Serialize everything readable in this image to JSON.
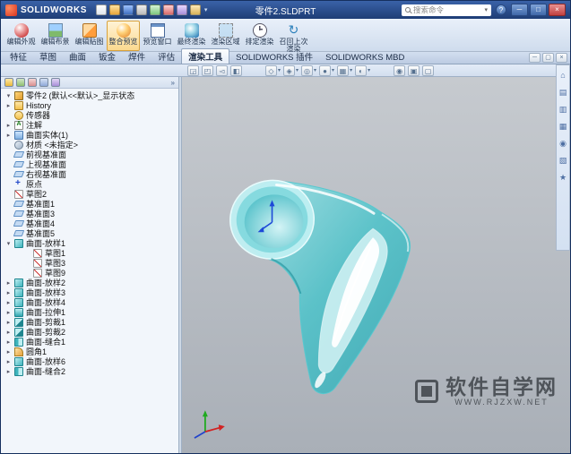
{
  "window": {
    "brand": "SOLIDWORKS",
    "title": "零件2.SLDPRT",
    "search_placeholder": "搜索命令",
    "menu_icons": [
      {
        "name": "new-file-icon",
        "icon": "new-file"
      },
      {
        "name": "open-file-icon",
        "icon": "open-file"
      },
      {
        "name": "save-icon",
        "icon": "save"
      },
      {
        "name": "print-icon",
        "icon": "print"
      },
      {
        "name": "undo-icon",
        "icon": "undo"
      },
      {
        "name": "rebuild-icon",
        "icon": "rebuild"
      },
      {
        "name": "file-properties-icon",
        "icon": "file-properties"
      },
      {
        "name": "options-icon",
        "icon": "options"
      }
    ],
    "controls": [
      {
        "name": "minimize-button",
        "glyph": "─"
      },
      {
        "name": "maximize-button",
        "glyph": "□"
      },
      {
        "name": "close-button",
        "glyph": "×"
      }
    ]
  },
  "ribbon": {
    "buttons": [
      {
        "label": "编辑外观",
        "icon": "edit-appearance"
      },
      {
        "label": "编辑布景",
        "icon": "edit-scene"
      },
      {
        "label": "编辑贴图",
        "icon": "edit-decal"
      },
      {
        "label": "整合预览",
        "icon": "integrated-preview",
        "active": "true"
      },
      {
        "label": "预览窗口",
        "icon": "preview-window"
      },
      {
        "label": "最终渲染",
        "icon": "final-render"
      },
      {
        "label": "渲染区域",
        "icon": "render-region"
      },
      {
        "label": "排定渲染",
        "icon": "schedule-render"
      },
      {
        "label": "召回上次渲染",
        "icon": "recall-last-render"
      }
    ]
  },
  "tabs": {
    "items": [
      {
        "label": "特征"
      },
      {
        "label": "草图"
      },
      {
        "label": "曲面"
      },
      {
        "label": "钣金"
      },
      {
        "label": "焊件"
      },
      {
        "label": "评估"
      },
      {
        "label": "渲染工具",
        "active": "true"
      },
      {
        "label": "SOLIDWORKS 插件"
      },
      {
        "label": "SOLIDWORKS MBD"
      }
    ],
    "right_icons": [
      {
        "name": "doc-minimize-icon",
        "glyph": "─"
      },
      {
        "name": "doc-restore-icon",
        "glyph": "▢"
      },
      {
        "name": "doc-close-icon",
        "glyph": "×"
      }
    ]
  },
  "viewbar": {
    "left_icons": [
      {
        "name": "zoom-fit-icon",
        "glyph": "◲"
      },
      {
        "name": "zoom-area-icon",
        "glyph": "◰"
      },
      {
        "name": "previous-view-icon",
        "glyph": "◅"
      },
      {
        "name": "section-view-icon",
        "glyph": "◧"
      }
    ],
    "center_icons": [
      {
        "name": "view-orientation-icon",
        "glyph": "◇"
      },
      {
        "name": "display-style-icon",
        "glyph": "◈"
      },
      {
        "name": "hide-show-items-icon",
        "glyph": "◎"
      },
      {
        "name": "edit-appearance-icon",
        "glyph": "●"
      },
      {
        "name": "apply-scene-icon",
        "glyph": "▦"
      },
      {
        "name": "view-settings-icon",
        "glyph": "◐"
      }
    ],
    "right_icons": [
      {
        "name": "camera-icon",
        "glyph": "◉"
      },
      {
        "name": "photoview-options-icon",
        "glyph": "▣"
      },
      {
        "name": "full-screen-icon",
        "glyph": "▢"
      }
    ]
  },
  "panel": {
    "header_icons": [
      {
        "name": "feature-manager-tab-icon",
        "icon": "feature-manager"
      },
      {
        "name": "property-manager-tab-icon",
        "icon": "property-manager"
      },
      {
        "name": "configuration-manager-tab-icon",
        "icon": "configuration-manager"
      },
      {
        "name": "dimxpert-manager-tab-icon",
        "icon": "dimxpert-manager"
      },
      {
        "name": "display-manager-tab-icon",
        "icon": "display-manager"
      }
    ],
    "header_more": "»"
  },
  "tree": {
    "items": [
      {
        "arrow": "▾",
        "icon": "part",
        "label": "零件2 (默认<<默认>_显示状态",
        "level": 0
      },
      {
        "arrow": "▸",
        "icon": "history",
        "label": "History",
        "level": 0
      },
      {
        "arrow": "",
        "icon": "sensors",
        "label": "传感器",
        "level": 0
      },
      {
        "arrow": "▸",
        "icon": "annotations",
        "label": "注解",
        "level": 0
      },
      {
        "arrow": "▸",
        "icon": "surface-bodies",
        "label": "曲面实体(1)",
        "level": 0
      },
      {
        "arrow": "",
        "icon": "material",
        "label": "材质 <未指定>",
        "level": 0
      },
      {
        "arrow": "",
        "icon": "plane",
        "label": "前视基准面",
        "level": 0
      },
      {
        "arrow": "",
        "icon": "plane",
        "label": "上视基准面",
        "level": 0
      },
      {
        "arrow": "",
        "icon": "plane",
        "label": "右视基准面",
        "level": 0
      },
      {
        "arrow": "",
        "icon": "origin",
        "label": "原点",
        "level": 0
      },
      {
        "arrow": "",
        "icon": "sketch",
        "label": "草图2",
        "level": 0
      },
      {
        "arrow": "",
        "icon": "plane",
        "label": "基准面1",
        "level": 0
      },
      {
        "arrow": "",
        "icon": "plane",
        "label": "基准面3",
        "level": 0
      },
      {
        "arrow": "",
        "icon": "plane",
        "label": "基准面4",
        "level": 0
      },
      {
        "arrow": "",
        "icon": "plane",
        "label": "基准面5",
        "level": 0
      },
      {
        "arrow": "▾",
        "icon": "surface-loft",
        "label": "曲面-放样1",
        "level": 0
      },
      {
        "arrow": "",
        "icon": "sketch",
        "label": "草图1",
        "level": 1
      },
      {
        "arrow": "",
        "icon": "sketch",
        "label": "草图3",
        "level": 1
      },
      {
        "arrow": "",
        "icon": "sketch",
        "label": "草图9",
        "level": 1
      },
      {
        "arrow": "▸",
        "icon": "surface-loft",
        "label": "曲面-放样2",
        "level": 0
      },
      {
        "arrow": "▸",
        "icon": "surface-loft",
        "label": "曲面-放样3",
        "level": 0
      },
      {
        "arrow": "▸",
        "icon": "surface-loft",
        "label": "曲面-放样4",
        "level": 0
      },
      {
        "arrow": "▸",
        "icon": "surface-extrude",
        "label": "曲面-拉伸1",
        "level": 0
      },
      {
        "arrow": "▸",
        "icon": "surface-trim",
        "label": "曲面-剪裁1",
        "level": 0
      },
      {
        "arrow": "▸",
        "icon": "surface-trim",
        "label": "曲面-剪裁2",
        "level": 0
      },
      {
        "arrow": "▸",
        "icon": "surface-knit",
        "label": "曲面-缝合1",
        "level": 0
      },
      {
        "arrow": "▸",
        "icon": "fillet",
        "label": "圆角1",
        "level": 0
      },
      {
        "arrow": "▸",
        "icon": "surface-loft",
        "label": "曲面-放样6",
        "level": 0
      },
      {
        "arrow": "▸",
        "icon": "surface-knit",
        "label": "曲面-缝合2",
        "level": 0
      }
    ]
  },
  "taskpane": {
    "icons": [
      {
        "name": "resources-home-icon",
        "glyph": "⌂"
      },
      {
        "name": "design-library-icon",
        "glyph": "▤"
      },
      {
        "name": "file-explorer-icon",
        "glyph": "▥"
      },
      {
        "name": "view-palette-icon",
        "glyph": "▦"
      },
      {
        "name": "appearances-scenes-icon",
        "glyph": "◉"
      },
      {
        "name": "custom-properties-icon",
        "glyph": "▧"
      },
      {
        "name": "forum-icon",
        "glyph": "★"
      }
    ]
  },
  "viewport": {
    "watermark_title": "软件自学网",
    "watermark_url": "WWW.RJZXW.NET"
  }
}
